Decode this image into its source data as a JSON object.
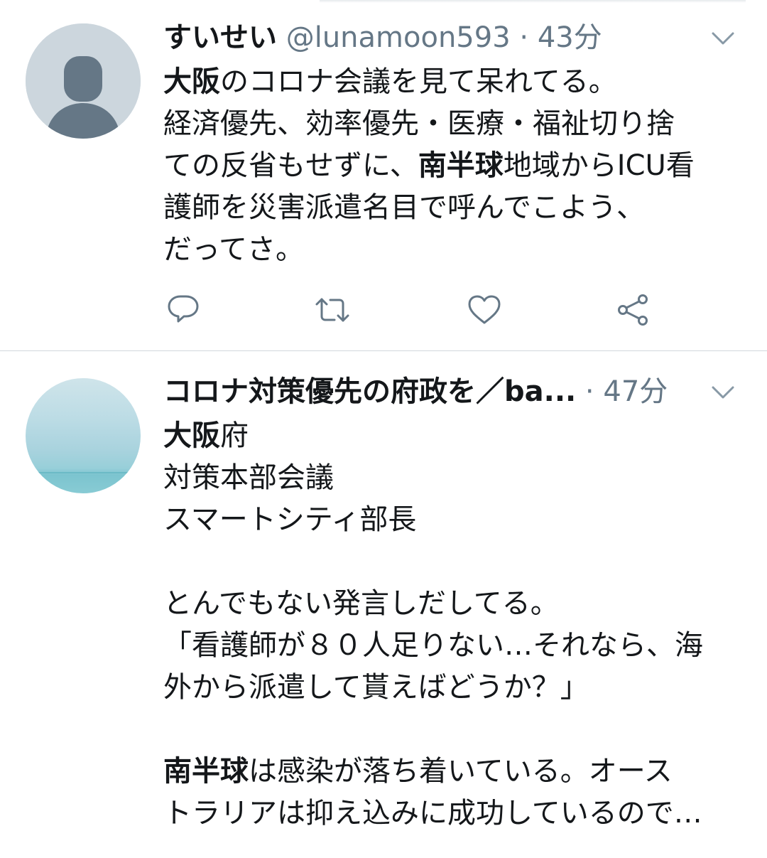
{
  "tweets": [
    {
      "display_name": "すいせい",
      "handle": "@lunamoon593",
      "separator": " · ",
      "time": "43分",
      "lines": [
        [
          {
            "b": "大阪"
          },
          {
            "t": "のコロナ会議を見て呆れてる。"
          }
        ],
        [
          {
            "t": "経済優先、効率優先・医療・福祉切り捨"
          }
        ],
        [
          {
            "t": "ての反省もせずに、"
          },
          {
            "b": "南半球"
          },
          {
            "t": "地域からICU看"
          }
        ],
        [
          {
            "t": "護師を災害派遣名目で呼んでこよう、"
          }
        ],
        [
          {
            "t": "だってさ。"
          }
        ]
      ],
      "actions": [
        "reply",
        "retweet",
        "like",
        "share"
      ]
    },
    {
      "display_name": "コロナ対策優先の府政を／ba...",
      "separator": " · ",
      "time": "47分",
      "lines": [
        [
          {
            "b": "大阪"
          },
          {
            "t": "府"
          }
        ],
        [
          {
            "t": "対策本部会議"
          }
        ],
        [
          {
            "t": "スマートシティ部長"
          }
        ],
        [
          {
            "t": ""
          }
        ],
        [
          {
            "t": "とんでもない発言しだしてる。"
          }
        ],
        [
          {
            "t": "「看護師が８０人足りない…それなら、海"
          }
        ],
        [
          {
            "t": "外から派遣して貰えばどうか？」"
          }
        ],
        [
          {
            "t": ""
          }
        ],
        [
          {
            "b": "南半球"
          },
          {
            "t": "は感染が落ち着いている。オース"
          }
        ],
        [
          {
            "t": "トラリアは抑え込みに成功しているので…"
          }
        ]
      ]
    }
  ],
  "colors": {
    "text": "#14171a",
    "secondary": "#657786",
    "divider": "#d2d7dc",
    "avatar_default": "#ccd6dd",
    "avatar_silhouette": "#657786"
  },
  "icons": {
    "caret": "chevron-down-icon",
    "reply": "reply-icon",
    "retweet": "retweet-icon",
    "like": "heart-icon",
    "share": "share-icon"
  }
}
